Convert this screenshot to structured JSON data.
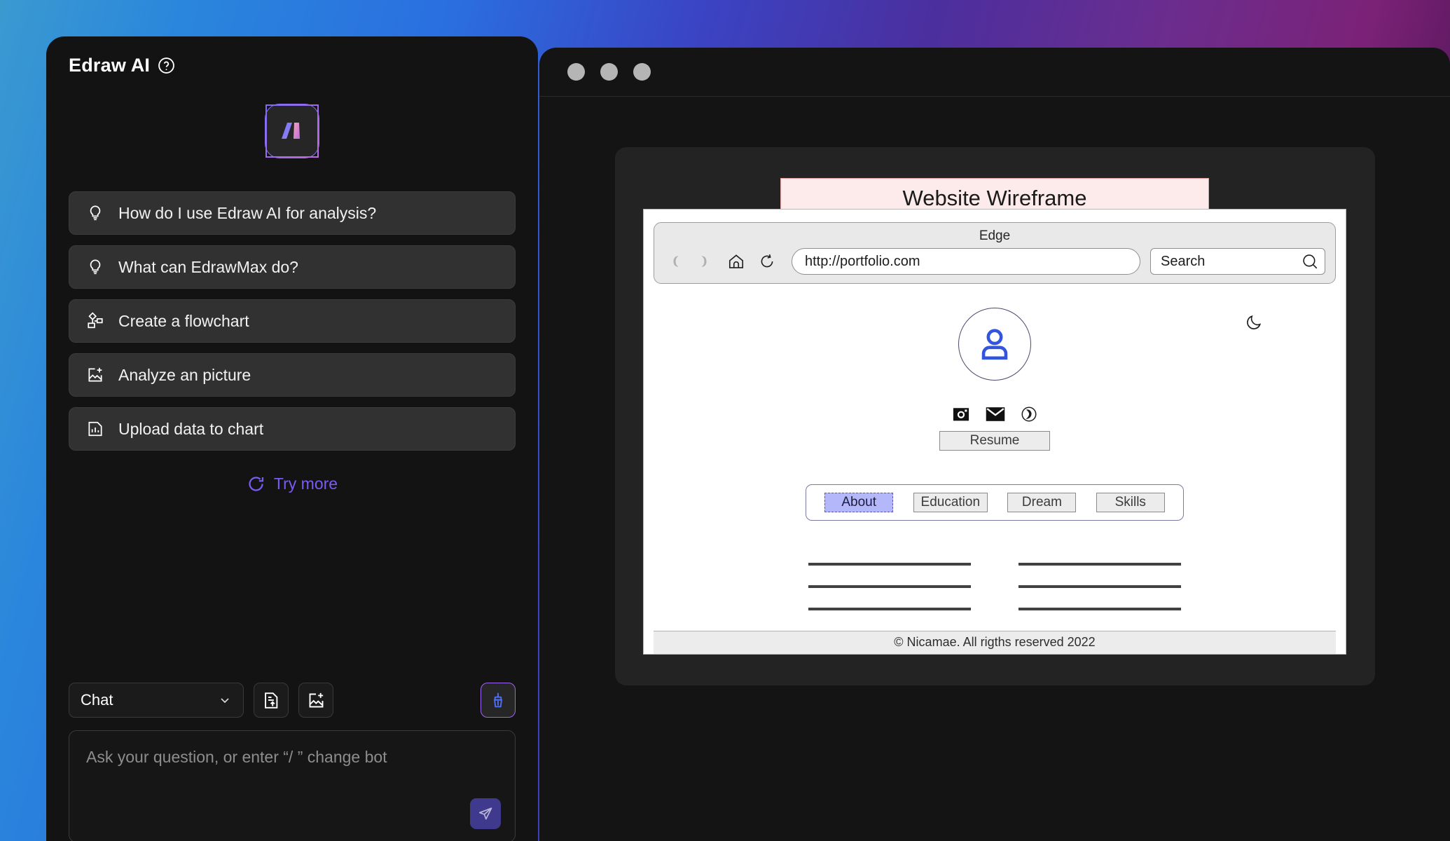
{
  "ai_panel": {
    "title": "Edraw AI",
    "help_icon": "help-circle-icon",
    "brand_logo": "edraw-ai-logo",
    "suggestions": [
      {
        "icon": "lightbulb-icon",
        "label": "How do I use Edraw AI for analysis?"
      },
      {
        "icon": "lightbulb-icon",
        "label": "What can EdrawMax do?"
      },
      {
        "icon": "flowchart-icon",
        "label": "Create a flowchart"
      },
      {
        "icon": "image-plus-icon",
        "label": "Analyze an picture"
      },
      {
        "icon": "chart-file-icon",
        "label": "Upload data to chart"
      }
    ],
    "try_more": {
      "icon": "refresh-icon",
      "label": "Try more"
    },
    "composer": {
      "mode_select": {
        "value": "Chat",
        "icon": "chevron-down-icon"
      },
      "upload_doc_icon": "document-upload-icon",
      "upload_image_icon": "image-plus-icon",
      "clear_icon": "broom-icon",
      "input_placeholder": "Ask your question, or enter  “/ ” change bot",
      "send_icon": "send-icon"
    }
  },
  "canvas_window": {
    "titlebar_dots": [
      "window-dot-1",
      "window-dot-2",
      "window-dot-3"
    ],
    "diagram": {
      "title": "Website Wireframe",
      "browser": {
        "chrome_title": "Edge",
        "back_icon": "back-arrow-icon",
        "forward_icon": "forward-arrow-icon",
        "home_icon": "home-icon",
        "reload_icon": "reload-icon",
        "url_value": "http://portfolio.com",
        "search_placeholder": "Search",
        "search_icon": "search-icon"
      },
      "page": {
        "theme_toggle_icon": "moon-icon",
        "avatar_icon": "user-avatar-icon",
        "social": [
          {
            "icon": "instagram-icon"
          },
          {
            "icon": "email-icon"
          },
          {
            "icon": "phone-icon"
          }
        ],
        "resume_button": "Resume",
        "nav_tabs": [
          {
            "label": "About",
            "active": true
          },
          {
            "label": "Education",
            "active": false
          },
          {
            "label": "Dream",
            "active": false
          },
          {
            "label": "Skills",
            "active": false
          }
        ],
        "footer": "© Nicamae. All rigths reserved 2022"
      }
    }
  },
  "colors": {
    "accent_purple": "#7a5cf0",
    "panel_bg": "#131313",
    "suggestion_bg": "#313131",
    "wireframe_title_bg": "#fdeaea",
    "active_tab_bg": "#b4b8fb",
    "avatar_blue": "#3355dd"
  }
}
